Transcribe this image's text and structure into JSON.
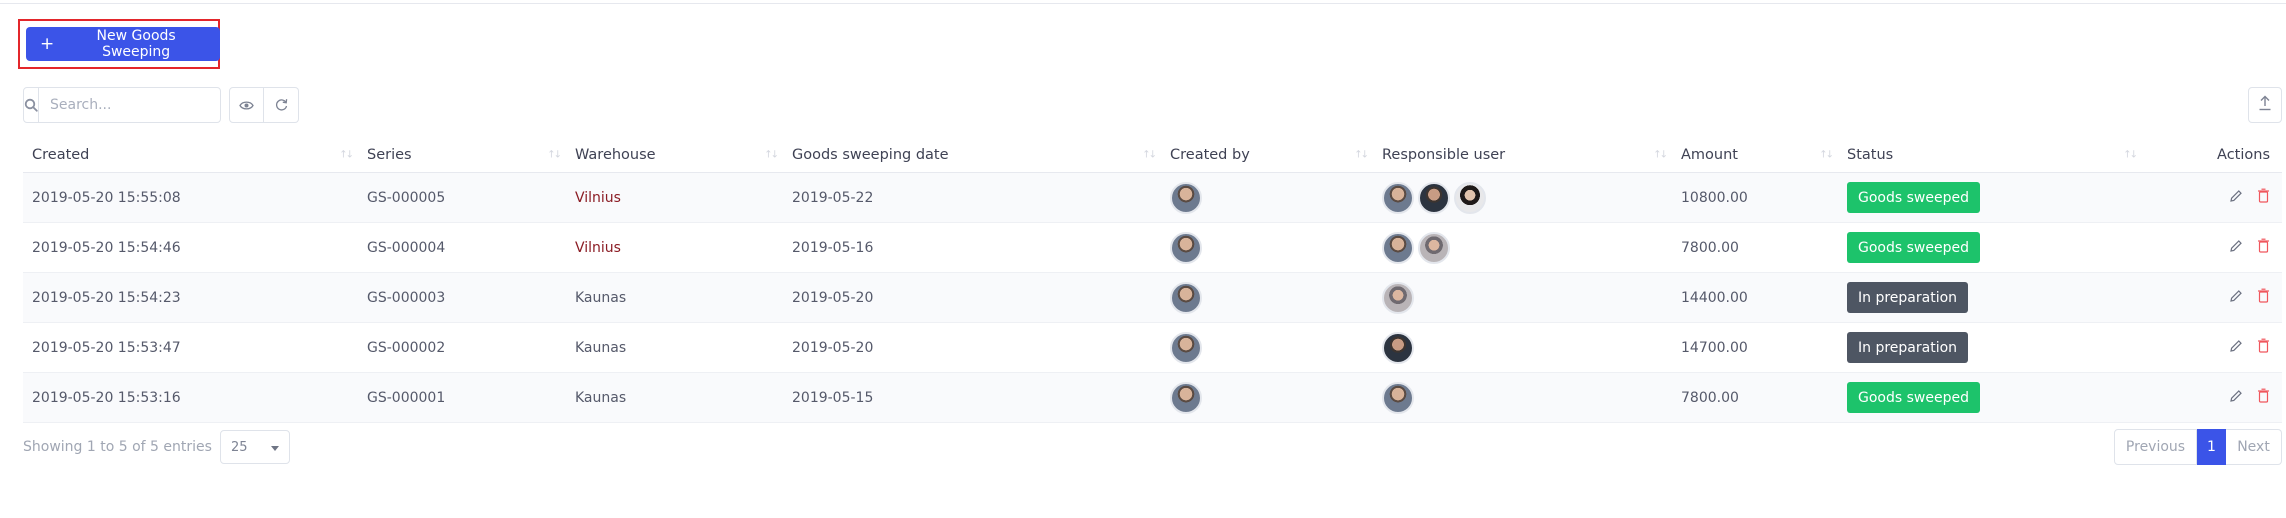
{
  "toolbar": {
    "new_label": "New Goods Sweeping",
    "search_placeholder": "Search..."
  },
  "table": {
    "columns": [
      "Created",
      "Series",
      "Warehouse",
      "Goods sweeping date",
      "Created by",
      "Responsible user",
      "Amount",
      "Status",
      "Actions"
    ],
    "rows": [
      {
        "created": "2019-05-20 15:55:08",
        "series": "GS-000005",
        "warehouse": "Vilnius",
        "date": "2019-05-22",
        "amount": "10800.00",
        "status": "Goods sweeped"
      },
      {
        "created": "2019-05-20 15:54:46",
        "series": "GS-000004",
        "warehouse": "Vilnius",
        "date": "2019-05-16",
        "amount": "7800.00",
        "status": "Goods sweeped"
      },
      {
        "created": "2019-05-20 15:54:23",
        "series": "GS-000003",
        "warehouse": "Kaunas",
        "date": "2019-05-20",
        "amount": "14400.00",
        "status": "In preparation"
      },
      {
        "created": "2019-05-20 15:53:47",
        "series": "GS-000002",
        "warehouse": "Kaunas",
        "date": "2019-05-20",
        "amount": "14700.00",
        "status": "In preparation"
      },
      {
        "created": "2019-05-20 15:53:16",
        "series": "GS-000001",
        "warehouse": "Kaunas",
        "date": "2019-05-15",
        "amount": "7800.00",
        "status": "Goods sweeped"
      }
    ]
  },
  "footer": {
    "info": "Showing 1 to 5 of 5 entries",
    "page_size": "25",
    "prev": "Previous",
    "current_page": "1",
    "next": "Next"
  },
  "colors": {
    "primary": "#3b54e8",
    "status_sweeped": "#1dc36b",
    "status_preparation": "#4e5663",
    "delete": "#f0565d",
    "highlight": "#e3262b"
  },
  "icons": [
    "plus-icon",
    "search-icon",
    "eye-icon",
    "refresh-icon",
    "upload-icon",
    "pencil-icon",
    "trash-icon",
    "caret-down-icon"
  ]
}
